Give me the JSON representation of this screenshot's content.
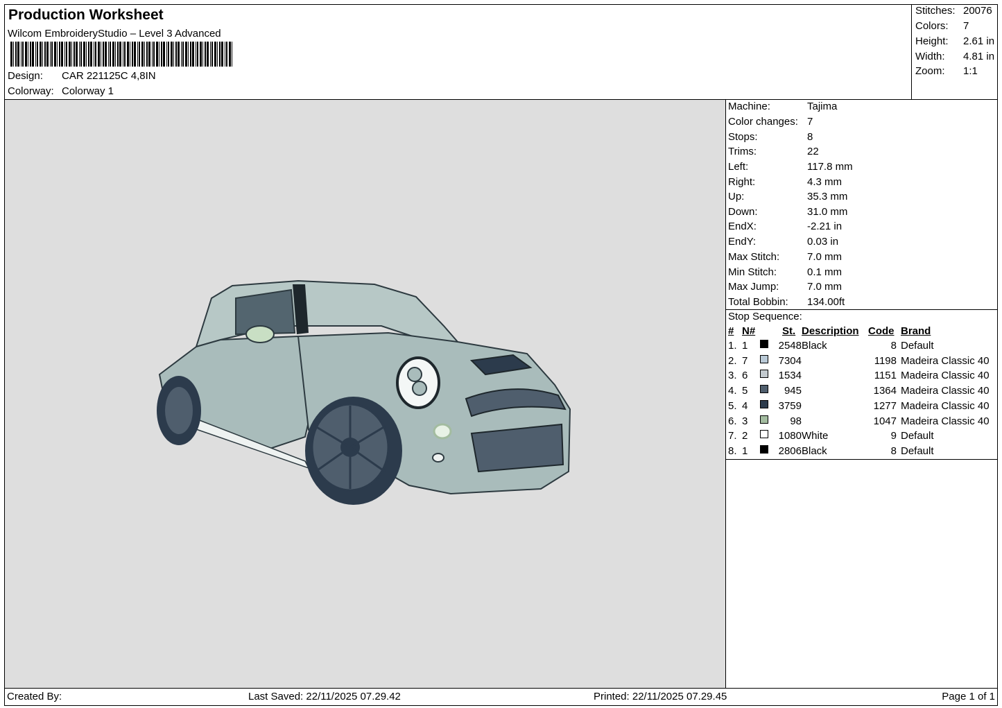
{
  "header": {
    "title": "Production Worksheet",
    "subtitle": "Wilcom EmbroideryStudio – Level 3 Advanced",
    "design_label": "Design:",
    "design_value": "CAR 221125C 4,8IN",
    "colorway_label": "Colorway:",
    "colorway_value": "Colorway 1"
  },
  "stats": [
    {
      "label": "Stitches:",
      "value": "20076"
    },
    {
      "label": "Colors:",
      "value": "7"
    },
    {
      "label": "Height:",
      "value": "2.61 in"
    },
    {
      "label": "Width:",
      "value": "4.81 in"
    },
    {
      "label": "Zoom:",
      "value": "1:1"
    }
  ],
  "machine_info": [
    {
      "label": "Machine:",
      "value": "Tajima"
    },
    {
      "label": "Color changes:",
      "value": "7"
    },
    {
      "label": "Stops:",
      "value": "8"
    },
    {
      "label": "Trims:",
      "value": "22"
    },
    {
      "label": "Left:",
      "value": "117.8 mm"
    },
    {
      "label": "Right:",
      "value": "4.3 mm"
    },
    {
      "label": "Up:",
      "value": "35.3 mm"
    },
    {
      "label": "Down:",
      "value": "31.0 mm"
    },
    {
      "label": "EndX:",
      "value": "-2.21 in"
    },
    {
      "label": "EndY:",
      "value": "0.03 in"
    },
    {
      "label": "Max Stitch:",
      "value": "7.0 mm"
    },
    {
      "label": "Min Stitch:",
      "value": "0.1 mm"
    },
    {
      "label": "Max Jump:",
      "value": "7.0 mm"
    },
    {
      "label": "Total Bobbin:",
      "value": "134.00ft"
    }
  ],
  "stop_sequence": {
    "title": "Stop Sequence:",
    "headers": {
      "idx": "#",
      "n": "N#",
      "st": "St.",
      "desc": "Description",
      "code": "Code",
      "brand": "Brand"
    },
    "rows": [
      {
        "idx": "1.",
        "n": "1",
        "color": "#000000",
        "st": "2548",
        "desc": "Black",
        "code": "8",
        "brand": "Default"
      },
      {
        "idx": "2.",
        "n": "7",
        "color": "#b9c9d6",
        "st": "7304",
        "desc": "",
        "code": "1198",
        "brand": "Madeira Classic 40"
      },
      {
        "idx": "3.",
        "n": "6",
        "color": "#c3cacf",
        "st": "1534",
        "desc": "",
        "code": "1151",
        "brand": "Madeira Classic 40"
      },
      {
        "idx": "4.",
        "n": "5",
        "color": "#4f5e6d",
        "st": "945",
        "desc": "",
        "code": "1364",
        "brand": "Madeira Classic 40"
      },
      {
        "idx": "5.",
        "n": "4",
        "color": "#2c3b4c",
        "st": "3759",
        "desc": "",
        "code": "1277",
        "brand": "Madeira Classic 40"
      },
      {
        "idx": "6.",
        "n": "3",
        "color": "#a3bca0",
        "st": "98",
        "desc": "",
        "code": "1047",
        "brand": "Madeira Classic 40"
      },
      {
        "idx": "7.",
        "n": "2",
        "color": "#ffffff",
        "st": "1080",
        "desc": "White",
        "code": "9",
        "brand": "Default"
      },
      {
        "idx": "8.",
        "n": "1",
        "color": "#000000",
        "st": "2806",
        "desc": "Black",
        "code": "8",
        "brand": "Default"
      }
    ]
  },
  "footer": {
    "created_by": "Created By:",
    "last_saved": "Last Saved: 22/11/2025 07.29.42",
    "printed": "Printed: 22/11/2025 07.29.45",
    "page": "Page 1 of 1"
  },
  "colors": {
    "canvas_bg": "#dedede",
    "car_body": "#a9bcbb",
    "car_dark": "#3f5360"
  }
}
